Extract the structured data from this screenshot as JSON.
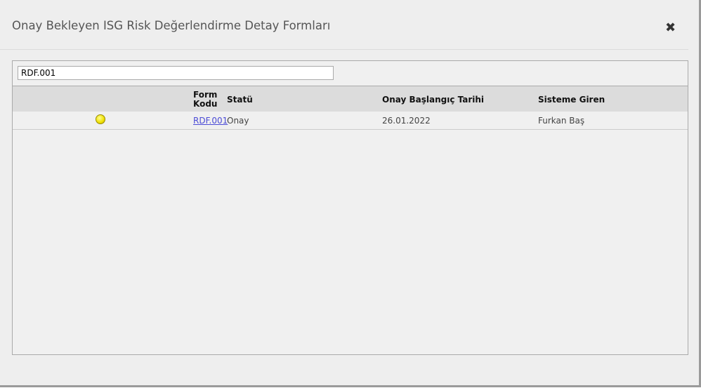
{
  "modal": {
    "title": "Onay Bekleyen ISG Risk Değerlendirme Detay Formları",
    "close_icon": "close-icon"
  },
  "search": {
    "value": "RDF.001"
  },
  "table": {
    "headers": {
      "status_icon": "",
      "form_code": "Form Kodu",
      "status": "Statü",
      "start_date": "Onay Başlangıç Tarihi",
      "entered_by": "Sisteme Giren"
    },
    "rows": [
      {
        "status_icon": "yellow-circle-icon",
        "form_code": "RDF.001",
        "status": "Onay",
        "start_date": "26.01.2022",
        "entered_by": "Furkan Baş"
      }
    ]
  },
  "colors": {
    "status_dot": "#f0e000",
    "link": "#4b4bd6"
  }
}
